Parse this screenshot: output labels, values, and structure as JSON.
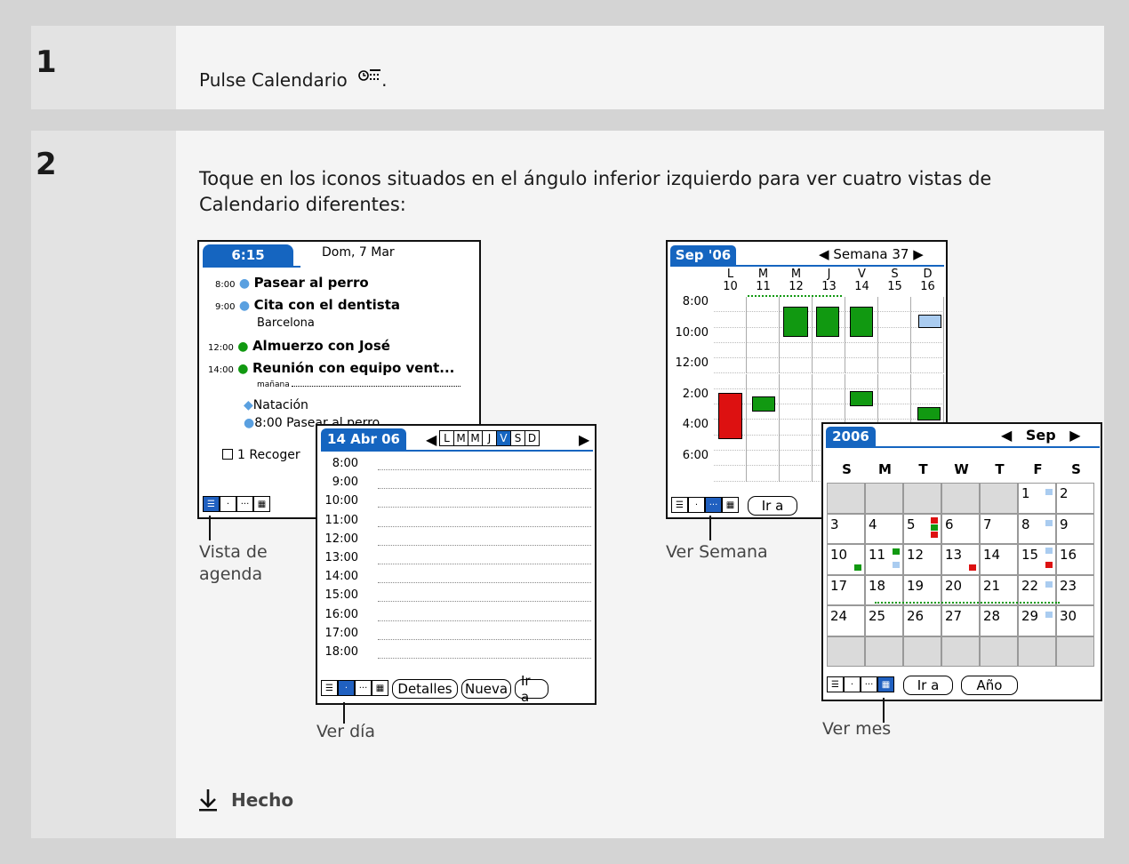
{
  "step1": {
    "number": "1",
    "text_before": "Pulse Calendario",
    "text_after": "."
  },
  "step2": {
    "number": "2",
    "text": "Toque en los iconos situados en el ángulo inferior izquierdo para ver cuatro vistas de Calendario diferentes:"
  },
  "agenda": {
    "time": "6:15",
    "date": "Dom, 7 Mar",
    "items": [
      {
        "time": "8:00",
        "title": "Pasear al perro",
        "sub": ""
      },
      {
        "time": "9:00",
        "title": "Cita con el dentista",
        "sub": "Barcelona"
      },
      {
        "time": "12:00",
        "title": "Almuerzo con José",
        "sub": ""
      },
      {
        "time": "14:00",
        "title": "Reunión con equipo vent...",
        "sub": ""
      }
    ],
    "tomorrow_label": "mañana",
    "tomorrow_items": [
      "Natación",
      "8:00 Pasear al perro"
    ],
    "task": "1 Recoger",
    "callout": [
      "Vista de",
      "agenda"
    ]
  },
  "day": {
    "date": "14 Abr 06",
    "weekdays": [
      "L",
      "M",
      "M",
      "J",
      "V",
      "S",
      "D"
    ],
    "hours": [
      "8:00",
      "9:00",
      "10:00",
      "11:00",
      "12:00",
      "13:00",
      "14:00",
      "15:00",
      "16:00",
      "17:00",
      "18:00"
    ],
    "buttons": {
      "details": "Detalles",
      "new": "Nueva",
      "go": "Ir a"
    },
    "callout": "Ver día"
  },
  "week": {
    "month": "Sep '06",
    "week_label": "Semana 37",
    "day_letters": [
      "L",
      "M",
      "M",
      "J",
      "V",
      "S",
      "D"
    ],
    "day_numbers": [
      "10",
      "11",
      "12",
      "13",
      "14",
      "15",
      "16"
    ],
    "hours": [
      "8:00",
      "10:00",
      "12:00",
      "2:00",
      "4:00",
      "6:00"
    ],
    "go": "Ir a",
    "callout": "Ver Semana"
  },
  "month": {
    "year": "2006",
    "month": "Sep",
    "weekdays": [
      "S",
      "M",
      "T",
      "W",
      "T",
      "F",
      "S"
    ],
    "weeks": [
      [
        "",
        "",
        "",
        "",
        "",
        "1",
        "2"
      ],
      [
        "3",
        "4",
        "5",
        "6",
        "7",
        "8",
        "9"
      ],
      [
        "10",
        "11",
        "12",
        "13",
        "14",
        "15",
        "16"
      ],
      [
        "17",
        "18",
        "19",
        "20",
        "21",
        "22",
        "23"
      ],
      [
        "24",
        "25",
        "26",
        "27",
        "28",
        "29",
        "30"
      ],
      [
        "",
        "",
        "",
        "",
        "",
        "",
        ""
      ]
    ],
    "go": "Ir a",
    "year_button": "Año",
    "callout": "Ver mes"
  },
  "done": {
    "label": "Hecho"
  },
  "colors": {
    "accent": "#1565c0",
    "event_green": "#119911",
    "event_red": "#dd1111",
    "event_blue": "#aaccf0",
    "bg": "#d4d4d4"
  }
}
